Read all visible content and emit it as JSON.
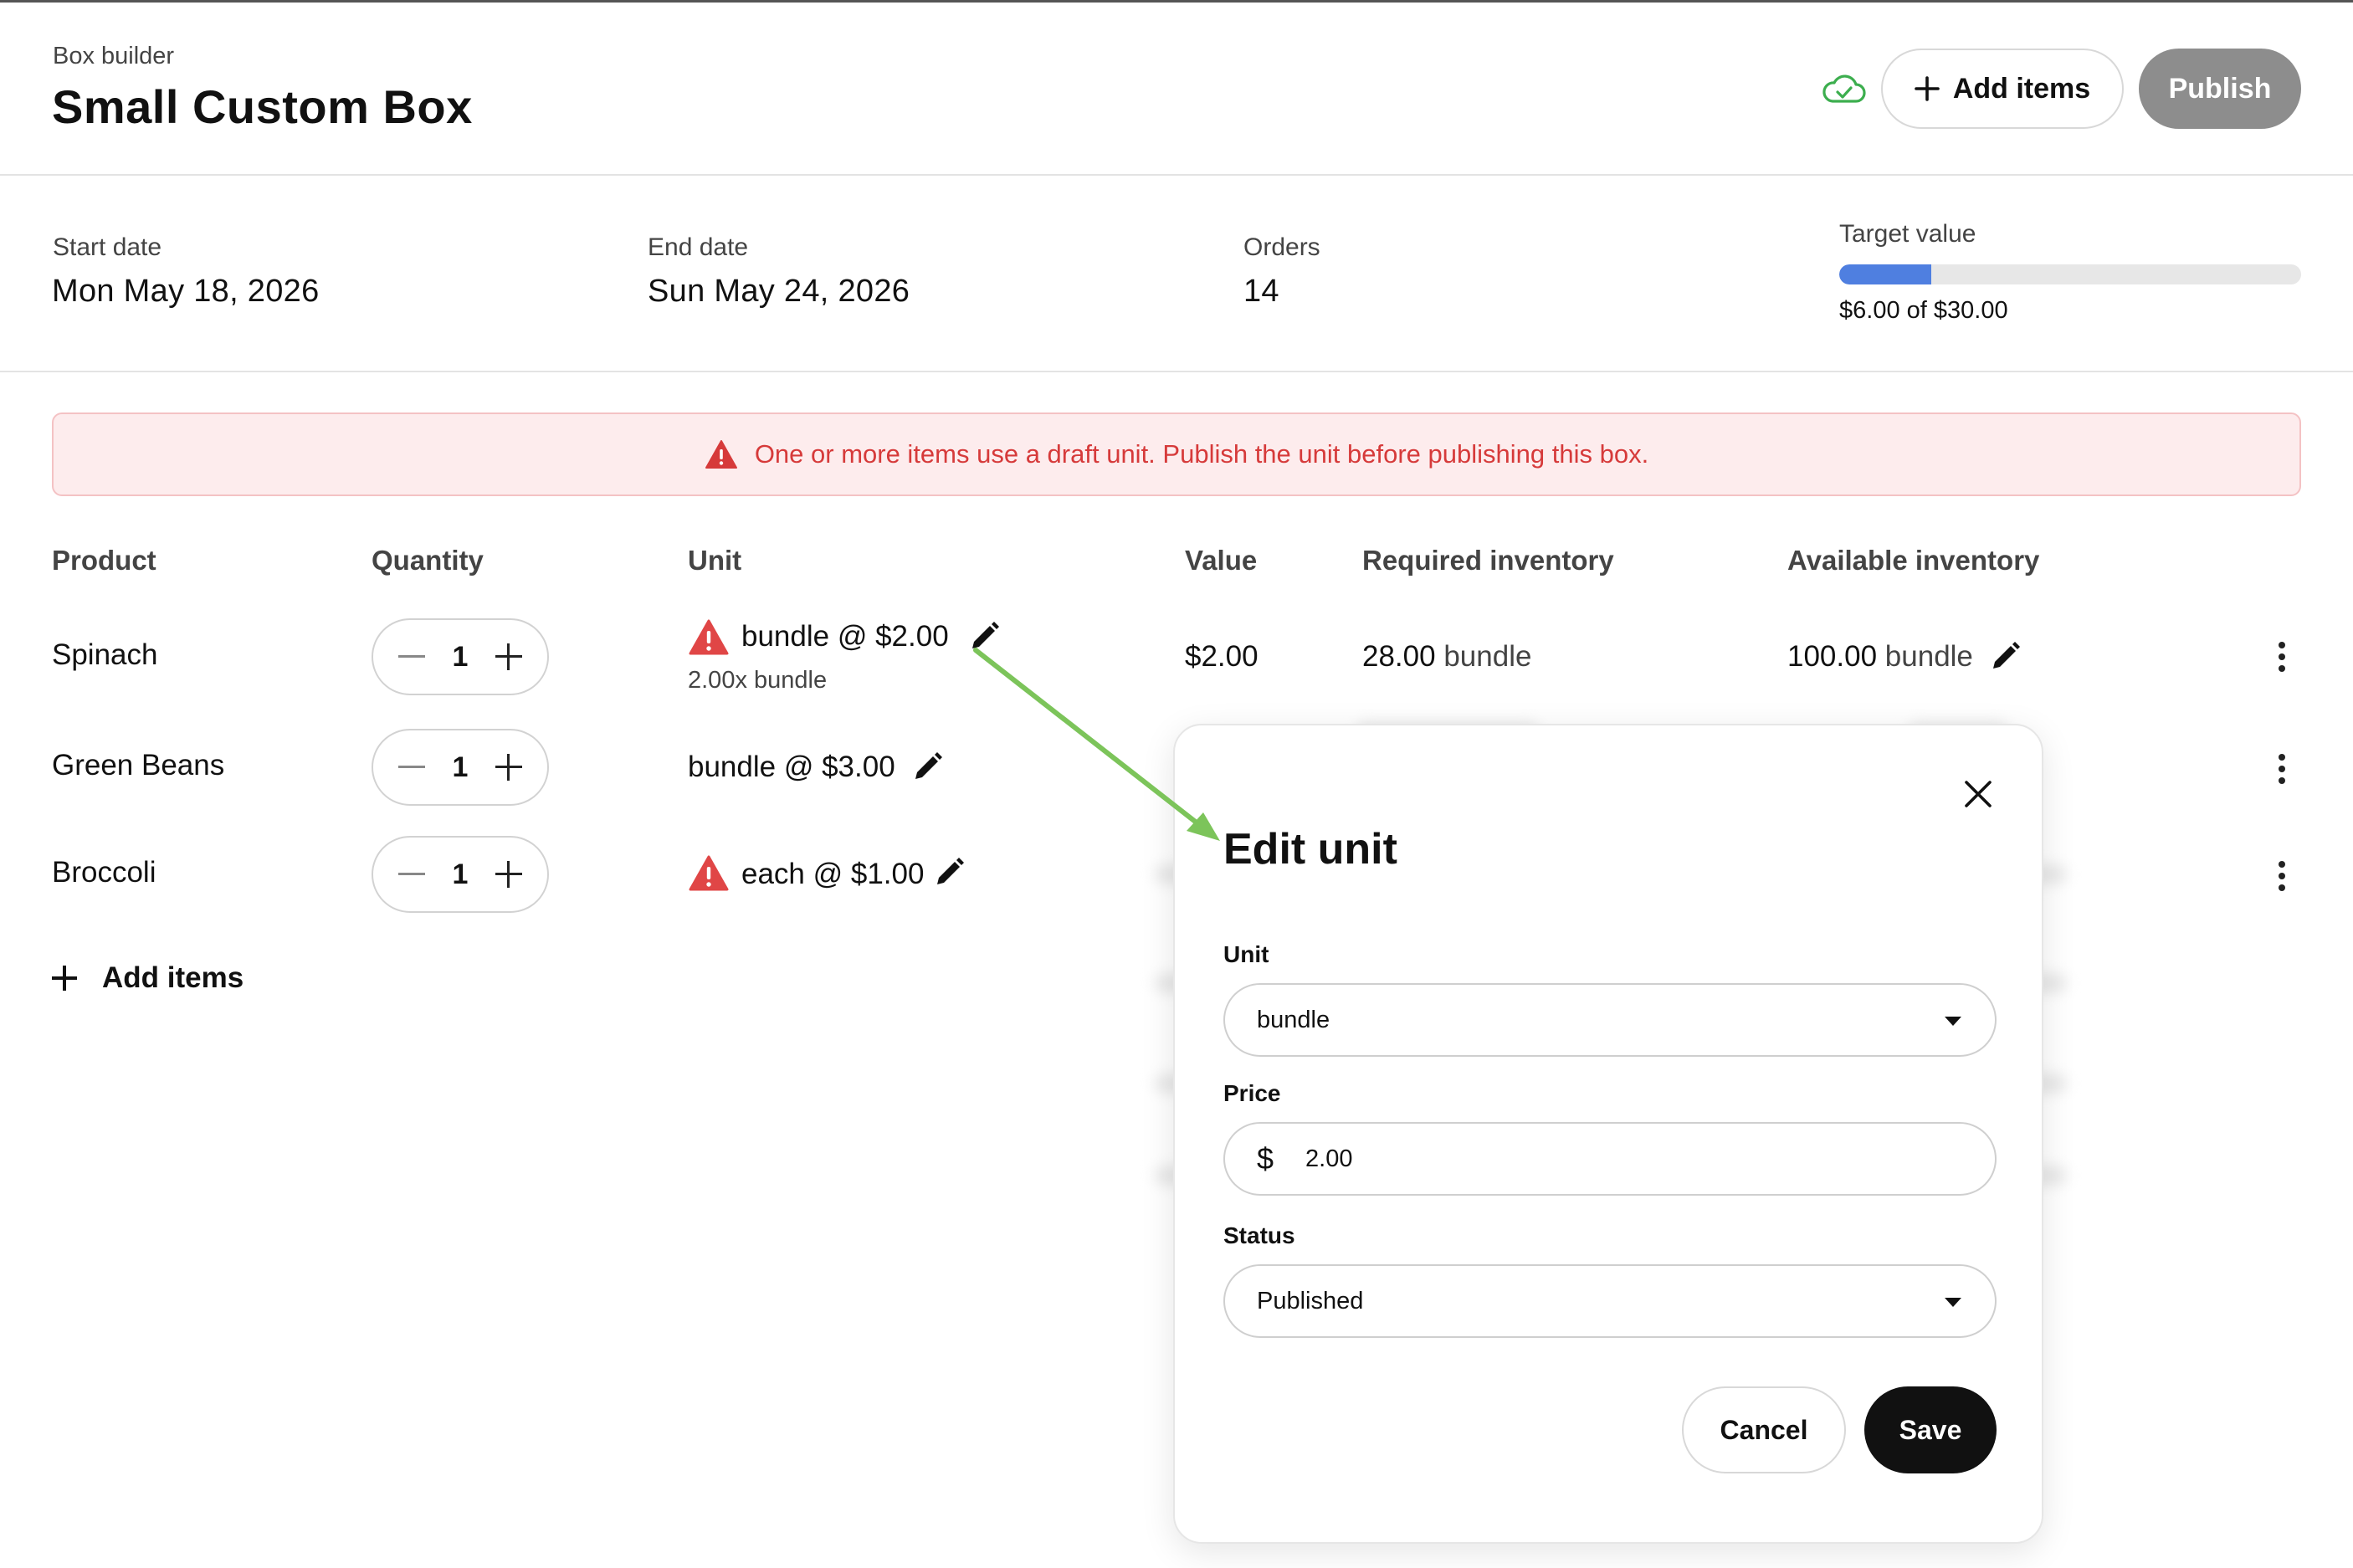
{
  "header": {
    "breadcrumb": "Box builder",
    "title": "Small Custom Box",
    "add_items_label": "Add items",
    "publish_label": "Publish",
    "sync_icon": "cloud-check-icon"
  },
  "stats": {
    "start_label": "Start date",
    "start_value": "Mon May 18, 2026",
    "end_label": "End date",
    "end_value": "Sun May 24, 2026",
    "orders_label": "Orders",
    "orders_value": "14",
    "target_label": "Target value",
    "target_caption": "$6.00 of $30.00",
    "target_progress": 0.2
  },
  "alert": {
    "message": "One or more items use a draft unit. Publish the unit before publishing this box.",
    "icon": "warning-triangle-icon"
  },
  "table": {
    "columns": [
      "Product",
      "Quantity",
      "Unit",
      "Value",
      "Required inventory",
      "Available inventory"
    ],
    "rows": [
      {
        "product": "Spinach",
        "quantity": "1",
        "unit": "bundle @ $2.00",
        "unit_sub": "2.00x bundle",
        "value": "$2.00",
        "required_amount": "28.00",
        "required_unit": "bundle",
        "available_amount": "100.00",
        "available_unit": "bundle",
        "draft_warning": true
      },
      {
        "product": "Green Beans",
        "quantity": "1",
        "unit": "bundle @ $3.00",
        "draft_warning": false
      },
      {
        "product": "Broccoli",
        "quantity": "1",
        "unit": "each @ $1.00",
        "draft_warning": true
      }
    ],
    "add_items_label": "Add items"
  },
  "modal": {
    "title": "Edit unit",
    "unit_label": "Unit",
    "unit_value": "bundle",
    "price_label": "Price",
    "price_currency": "$",
    "price_value": "2.00",
    "status_label": "Status",
    "status_value": "Published",
    "cancel_label": "Cancel",
    "save_label": "Save"
  },
  "colors": {
    "accent_blue": "#4f7fe0",
    "alert_red": "#d63a3a",
    "alert_bg": "#fdeced",
    "sync_green": "#3cae4e",
    "annotation_arrow": "#7cc45a"
  }
}
